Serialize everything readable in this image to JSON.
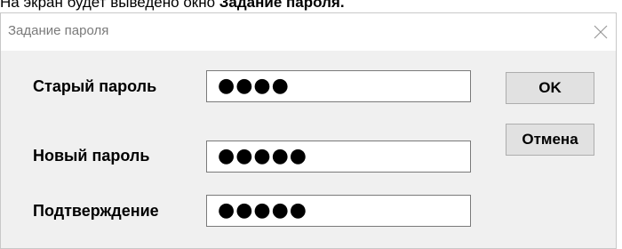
{
  "document": {
    "intro_text": "На экран будет выведено окно ",
    "intro_bold": "Задание пароля."
  },
  "dialog": {
    "title": "Задание пароля",
    "fields": {
      "old_password": {
        "label": "Старый пароль",
        "value": "●●●●"
      },
      "new_password": {
        "label": "Новый пароль",
        "value": "●●●●●"
      },
      "confirm": {
        "label": "Подтверждение",
        "value": "●●●●●"
      }
    },
    "buttons": {
      "ok": "OK",
      "cancel": "Отмена"
    }
  },
  "icons": {
    "close": "close-icon"
  }
}
